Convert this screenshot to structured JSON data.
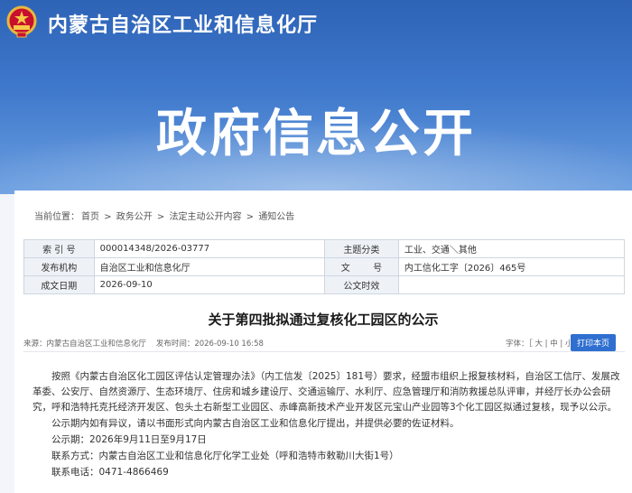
{
  "site": {
    "name": "内蒙古自治区工业和信息化厅",
    "banner_title": "政府信息公开",
    "emblem_icon": "national-emblem-icon"
  },
  "breadcrumb": {
    "prefix": "当前位置：",
    "items": [
      "首页",
      "政务公开",
      "法定主动公开内容",
      "通知公告"
    ],
    "separator": " > "
  },
  "meta": {
    "index_label": "索 引 号",
    "index_value": "000014348/2026-03777",
    "topic_label": "主题分类",
    "topic_value": "工业、交通＼其他",
    "org_label": "发布机构",
    "org_value": "自治区工业和信息化厅",
    "docno_label": "文        号",
    "docno_value": "内工信化工字〔2026〕465号",
    "date_label": "成文日期",
    "date_value": "2026-09-10",
    "validity_label": "公文时效",
    "validity_value": ""
  },
  "article": {
    "title": "关于第四批拟通过复核化工园区的公示",
    "source": "来源：内蒙古自治区工业和信息化厅",
    "publish_time": "发布时间：2026-09-10 16:58",
    "font_size_label": "字体：",
    "font_size_options": "［ 大 | 中 | 小 ］",
    "print_label": "打印本页",
    "para1": "按照《内蒙古自治区化工园区评估认定管理办法》（内工信发〔2025〕181号）要求，经盟市组织上报复核材料，自治区工信厅、发展改革委、公安厅、自然资源厅、生态环境厅、住房和城乡建设厅、交通运输厅、水利厅、应急管理厅和消防救援总队评审，并经厅长办公会研究，呼和浩特托克托经济开发区、包头土右新型工业园区、赤峰高新技术产业开发区元宝山产业园等3个化工园区拟通过复核，现予以公示。",
    "para2": "公示期内如有异议，请以书面形式向内蒙古自治区工业和信息化厅提出，并提供必要的佐证材料。",
    "period": "公示期：2026年9月11日至9月17日",
    "contact": "联系方式：内蒙古自治区工业和信息化厅化学工业处（呼和浩特市敕勒川大街1号）",
    "phone": "联系电话：0471-4866469"
  }
}
